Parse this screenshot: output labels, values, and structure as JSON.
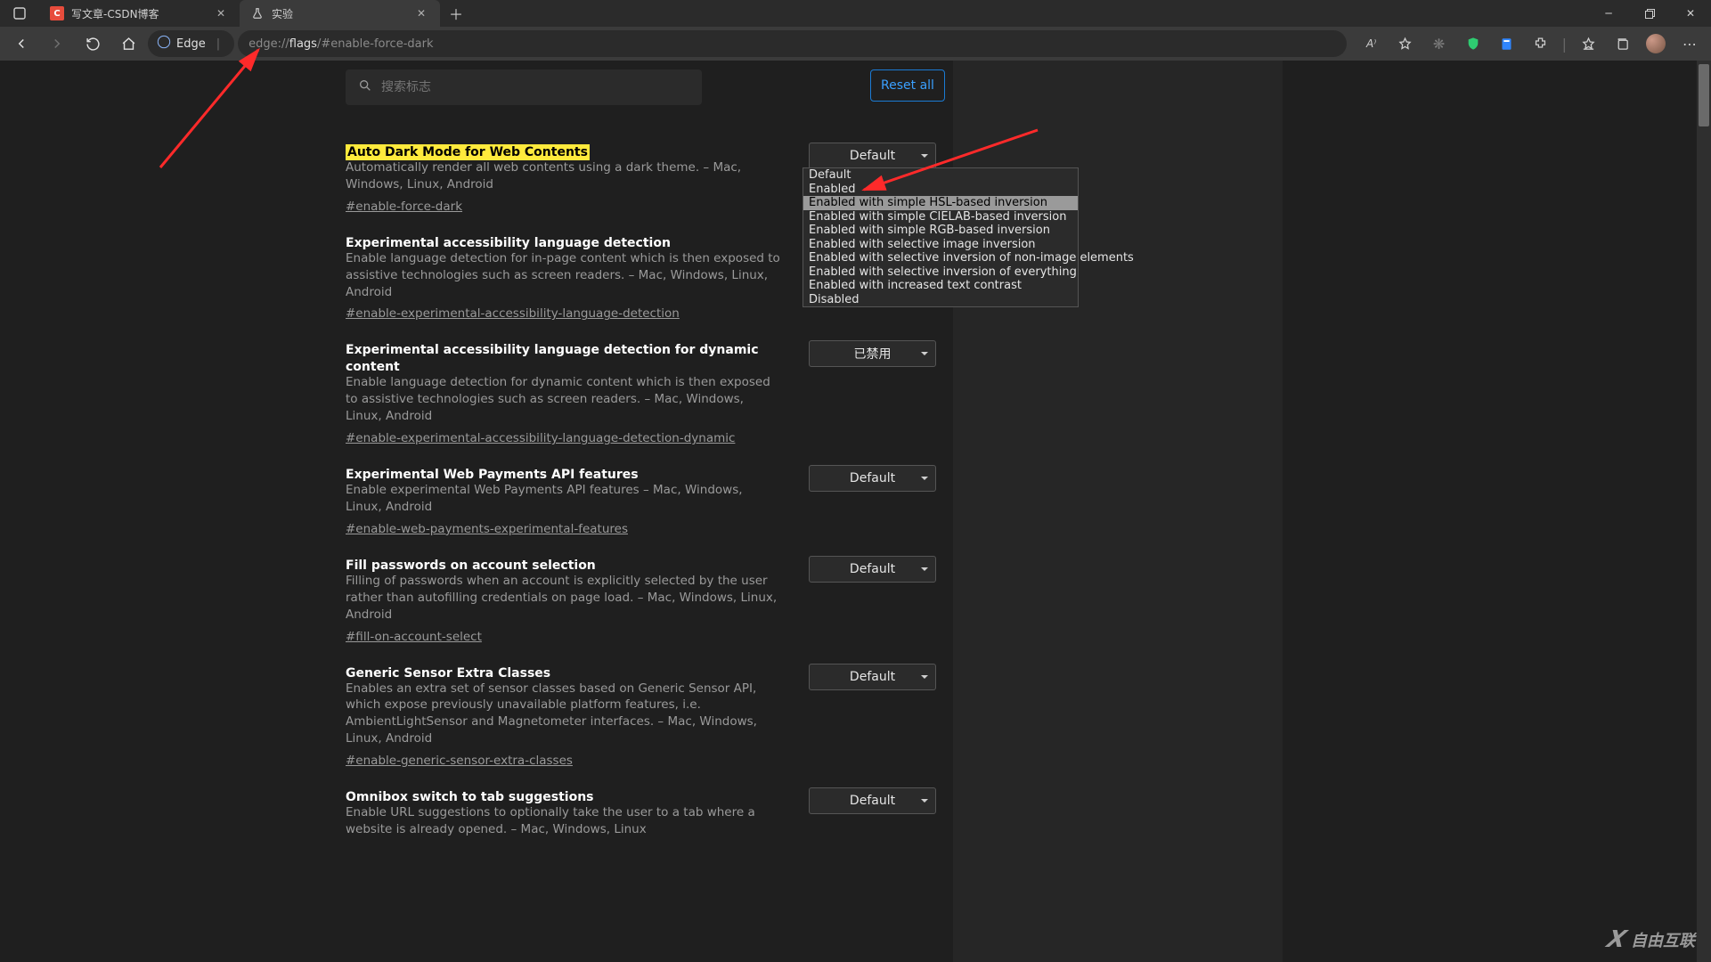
{
  "tabs": [
    {
      "title": "写文章-CSDN博客",
      "active": false
    },
    {
      "title": "实验",
      "active": true
    }
  ],
  "address": {
    "edge_label": "Edge",
    "prefix": "edge://",
    "flagword": "flags",
    "suffix": "/#enable-force-dark"
  },
  "search_placeholder": "搜索标志",
  "reset_label": "Reset all",
  "dropdown_options": [
    "Default",
    "Enabled",
    "Enabled with simple HSL-based inversion",
    "Enabled with simple CIELAB-based inversion",
    "Enabled with simple RGB-based inversion",
    "Enabled with selective image inversion",
    "Enabled with selective inversion of non-image elements",
    "Enabled with selective inversion of everything",
    "Enabled with increased text contrast",
    "Disabled"
  ],
  "dropdown_highlight_index": 2,
  "flags": [
    {
      "title": "Auto Dark Mode for Web Contents",
      "desc": "Automatically render all web contents using a dark theme. – Mac, Windows, Linux, Android",
      "anchor": "#enable-force-dark",
      "select": "Default",
      "highlight": true
    },
    {
      "title": "Experimental accessibility language detection",
      "desc": "Enable language detection for in-page content which is then exposed to assistive technologies such as screen readers. – Mac, Windows, Linux, Android",
      "anchor": "#enable-experimental-accessibility-language-detection",
      "select": ""
    },
    {
      "title": "Experimental accessibility language detection for dynamic content",
      "desc": "Enable language detection for dynamic content which is then exposed to assistive technologies such as screen readers. – Mac, Windows, Linux, Android",
      "anchor": "#enable-experimental-accessibility-language-detection-dynamic",
      "select": "已禁用"
    },
    {
      "title": "Experimental Web Payments API features",
      "desc": "Enable experimental Web Payments API features – Mac, Windows, Linux, Android",
      "anchor": "#enable-web-payments-experimental-features",
      "select": "Default"
    },
    {
      "title": "Fill passwords on account selection",
      "desc": "Filling of passwords when an account is explicitly selected by the user rather than autofilling credentials on page load. – Mac, Windows, Linux, Android",
      "anchor": "#fill-on-account-select",
      "select": "Default"
    },
    {
      "title": "Generic Sensor Extra Classes",
      "desc": "Enables an extra set of sensor classes based on Generic Sensor API, which expose previously unavailable platform features, i.e. AmbientLightSensor and Magnetometer interfaces. – Mac, Windows, Linux, Android",
      "anchor": "#enable-generic-sensor-extra-classes",
      "select": "Default"
    },
    {
      "title": "Omnibox switch to tab suggestions",
      "desc": "Enable URL suggestions to optionally take the user to a tab where a website is already opened. – Mac, Windows, Linux",
      "anchor": "",
      "select": "Default"
    }
  ],
  "watermark": "自由互联"
}
